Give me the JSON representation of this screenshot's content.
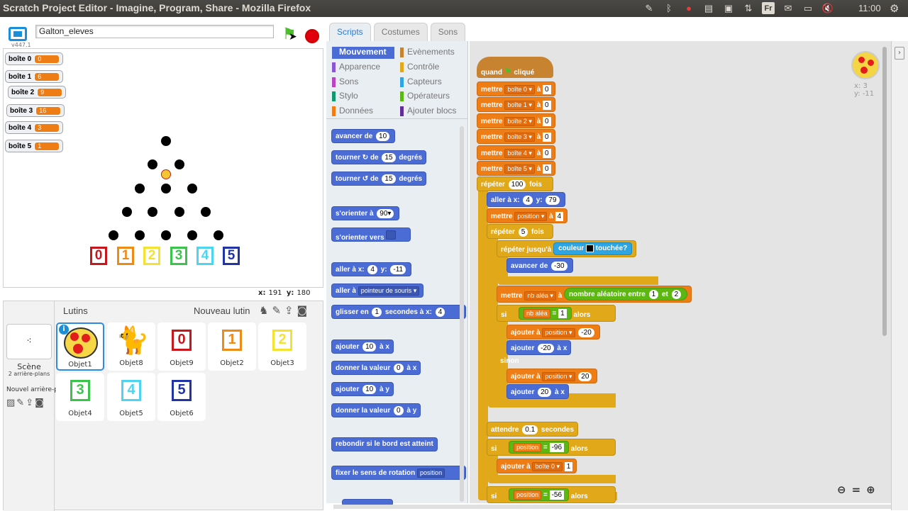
{
  "window": {
    "title": "Scratch Project Editor - Imagine, Program, Share - Mozilla Firefox",
    "clock": "11:00",
    "tray_icons": [
      "pencil-icon",
      "bluetooth-icon",
      "record-icon",
      "clipboard-icon",
      "window-icon",
      "sort-icon",
      "keyboard-fr-icon",
      "mail-icon",
      "battery-icon",
      "mute-icon"
    ],
    "keyboard_label": "Fr"
  },
  "project": {
    "name": "Galton_eleves",
    "version": "v447.1"
  },
  "monitors": [
    {
      "label": "boîte 0",
      "value": "0"
    },
    {
      "label": "boîte 1",
      "value": "6"
    },
    {
      "label": "boîte 2",
      "value": "9"
    },
    {
      "label": "boîte 3",
      "value": "16"
    },
    {
      "label": "boîte 4",
      "value": "3"
    },
    {
      "label": "boîte 5",
      "value": "1"
    }
  ],
  "stage_boxes": [
    {
      "digit": "0",
      "color": "#c8161d"
    },
    {
      "digit": "1",
      "color": "#ee8a16"
    },
    {
      "digit": "2",
      "color": "#f5e132"
    },
    {
      "digit": "3",
      "color": "#3ac44b"
    },
    {
      "digit": "4",
      "color": "#4fd4f0"
    },
    {
      "digit": "5",
      "color": "#2134a6"
    }
  ],
  "stage_coords": {
    "x_label": "x:",
    "x": "191",
    "y_label": "y:",
    "y": "180"
  },
  "sprite_pane": {
    "title": "Lutins",
    "new_sprite": "Nouveau lutin",
    "scene_label": "Scène",
    "scene_backdrops": "2 arrière-plans",
    "new_backdrop": "Nouvel arrière-plan",
    "sprites": [
      {
        "name": "Objet1",
        "kind": "ball"
      },
      {
        "name": "Objet8",
        "kind": "cat"
      },
      {
        "name": "Objet9",
        "kind": "box",
        "digit": "0",
        "color": "#c8161d"
      },
      {
        "name": "Objet2",
        "kind": "box",
        "digit": "1",
        "color": "#ee8a16"
      },
      {
        "name": "Objet3",
        "kind": "box",
        "digit": "2",
        "color": "#f5e132"
      },
      {
        "name": "Objet4",
        "kind": "box",
        "digit": "3",
        "color": "#3ac44b"
      },
      {
        "name": "Objet5",
        "kind": "box",
        "digit": "4",
        "color": "#4fd4f0"
      },
      {
        "name": "Objet6",
        "kind": "box",
        "digit": "5",
        "color": "#2134a6"
      }
    ]
  },
  "tabs": [
    "Scripts",
    "Costumes",
    "Sons"
  ],
  "categories_left": [
    {
      "label": "Mouvement",
      "color": "#4a6cd4",
      "selected": true
    },
    {
      "label": "Apparence",
      "color": "#8a55d7"
    },
    {
      "label": "Sons",
      "color": "#bb42c3"
    },
    {
      "label": "Stylo",
      "color": "#0e9a6c"
    },
    {
      "label": "Données",
      "color": "#ee7d16"
    }
  ],
  "categories_right": [
    {
      "label": "Evènements",
      "color": "#c88330"
    },
    {
      "label": "Contrôle",
      "color": "#e1a91a"
    },
    {
      "label": "Capteurs",
      "color": "#2ca5e2"
    },
    {
      "label": "Opérateurs",
      "color": "#5cb712"
    },
    {
      "label": "Ajouter blocs",
      "color": "#632d99"
    }
  ],
  "palette": {
    "move": {
      "a": "avancer de",
      "v": "10"
    },
    "turn_r": {
      "a": "tourner",
      "b": "de",
      "v": "15",
      "c": "degrés"
    },
    "turn_l": {
      "a": "tourner",
      "b": "de",
      "v": "15",
      "c": "degrés"
    },
    "point_dir": {
      "a": "s'orienter à",
      "v": "90▾"
    },
    "point_towards": {
      "a": "s'orienter vers"
    },
    "goto_xy": {
      "a": "aller à x:",
      "x": "4",
      "b": "y:",
      "y": "-11"
    },
    "goto": {
      "a": "aller à",
      "d": "pointeur de souris ▾"
    },
    "glide": {
      "a": "glisser en",
      "v": "1",
      "b": "secondes à x:",
      "x": "4"
    },
    "change_x": {
      "a": "ajouter",
      "v": "10",
      "b": "à x"
    },
    "set_x": {
      "a": "donner la valeur",
      "v": "0",
      "b": "à x"
    },
    "change_y": {
      "a": "ajouter",
      "v": "10",
      "b": "à y"
    },
    "set_y": {
      "a": "donner la valeur",
      "v": "0",
      "b": "à y"
    },
    "bounce": "rebondir si le bord est atteint",
    "rotation": {
      "a": "fixer le sens de rotation",
      "d": "position"
    }
  },
  "script": {
    "hat": {
      "a": "quand",
      "b": "cliqué"
    },
    "set_word": "mettre",
    "to_word": "à",
    "sets": [
      {
        "var": "boîte 0 ▾",
        "val": "0"
      },
      {
        "var": "boîte 1 ▾",
        "val": "0"
      },
      {
        "var": "boîte 2 ▾",
        "val": "0"
      },
      {
        "var": "boîte 3 ▾",
        "val": "0"
      },
      {
        "var": "boîte 4 ▾",
        "val": "0"
      },
      {
        "var": "boîte 5 ▾",
        "val": "0"
      }
    ],
    "repeat1": {
      "a": "répéter",
      "v": "100",
      "b": "fois"
    },
    "goto": {
      "a": "aller à x:",
      "x": "4",
      "b": "y:",
      "y": "79"
    },
    "set_pos": {
      "a": "mettre",
      "d": "position ▾",
      "b": "à",
      "v": "4"
    },
    "repeat2": {
      "a": "répéter",
      "v": "5",
      "b": "fois"
    },
    "until": {
      "a": "répéter jusqu'à",
      "s1": "couleur",
      "s2": "touchée?"
    },
    "move": {
      "a": "avancer de",
      "v": "-30"
    },
    "set_rand": {
      "a": "mettre",
      "d": "nb aléa ▾",
      "b": "à",
      "c": "nombre aléatoire entre",
      "v1": "1",
      "e": "et",
      "v2": "2"
    },
    "if1": {
      "a": "si",
      "d": "nb aléa",
      "eq": "=",
      "v": "1",
      "b": "alors"
    },
    "add_pos1": {
      "a": "ajouter à",
      "d": "position ▾",
      "v": "-20"
    },
    "addx1": {
      "a": "ajouter",
      "v": "-20",
      "b": "à x"
    },
    "else": "sinon",
    "add_pos2": {
      "a": "ajouter à",
      "d": "position ▾",
      "v": "20"
    },
    "addx2": {
      "a": "ajouter",
      "v": "20",
      "b": "à x"
    },
    "wait": {
      "a": "attendre",
      "v": "0.1",
      "b": "secondes"
    },
    "if2": {
      "a": "si",
      "d": "position",
      "eq": "=",
      "v": "-96",
      "b": "alors"
    },
    "add_box0": {
      "a": "ajouter à",
      "d": "boîte 0 ▾",
      "v": "1"
    },
    "if3": {
      "a": "si",
      "d": "position",
      "eq": "=",
      "v": "-56",
      "b": "alors"
    }
  },
  "sprite_info": {
    "x_label": "x:",
    "x": "3",
    "y_label": "y:",
    "y": "-11"
  }
}
